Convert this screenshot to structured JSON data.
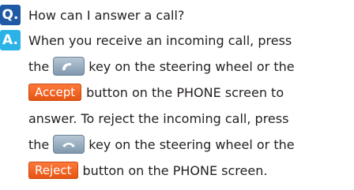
{
  "question": {
    "badge": "Q.",
    "text": "How can I answer a call?"
  },
  "answer": {
    "badge": "A.",
    "line1": "When you receive an incoming call, press",
    "line2_pre": "the",
    "line2_post": "key on the steering wheel or the",
    "line3_button": "Accept",
    "line3_post": "button on the PHONE screen to",
    "line4": "answer. To reject the incoming call, press",
    "line5_pre": "the",
    "line5_post": "key on the steering wheel or the",
    "line6_button": "Reject",
    "line6_post": "button on the PHONE screen."
  },
  "icons": {
    "accept_key": "phone-pickup-icon",
    "reject_key": "phone-hangup-icon"
  },
  "colors": {
    "q_badge": "#1f5aa5",
    "a_badge": "#2bb3e8",
    "button": "#e45311"
  }
}
